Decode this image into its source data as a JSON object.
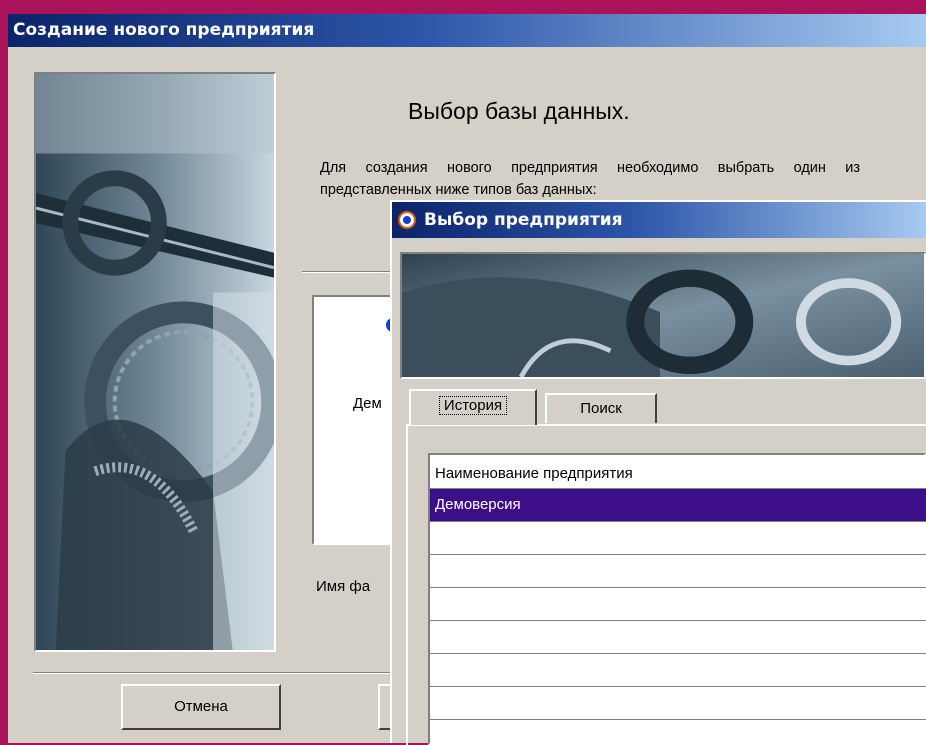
{
  "main_window": {
    "title": "Создание нового предприятия",
    "heading": "Выбор базы данных.",
    "description": "Для создания нового предприятия необходимо выбрать один из представленных ниже типов баз данных:",
    "list_item_label": "Дем",
    "filename_label": "Имя фа",
    "cancel_label": "Отмена"
  },
  "dialog": {
    "title": "Выбор предприятия",
    "tabs": [
      {
        "label": "История"
      },
      {
        "label": "Поиск"
      }
    ],
    "grid": {
      "header": "Наименование предприятия",
      "rows": [
        "Демоверсия"
      ]
    }
  },
  "colors": {
    "desktop": "#a8135a",
    "selection": "#3c0e88",
    "title_start": "#0a246a"
  }
}
